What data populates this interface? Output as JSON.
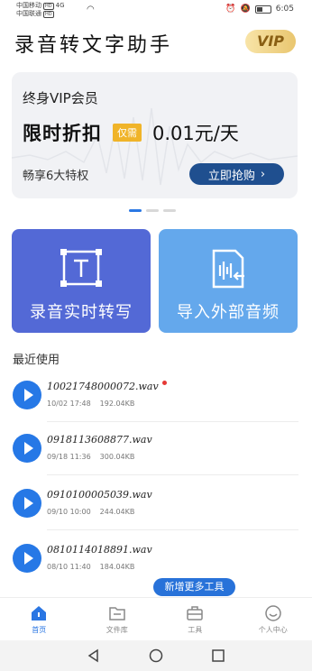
{
  "status_bar": {
    "carrier1": "中国移动",
    "carrier2": "中国联通",
    "hd": "HD",
    "net": "4G",
    "battery_level": 0.45,
    "battery_text": "Ⓔ",
    "time": "6:05"
  },
  "header": {
    "title": "录音转文字助手",
    "vip_badge": "VIP"
  },
  "vip_card": {
    "title": "终身VIP会员",
    "promo": "限时折扣",
    "tag": "仅需",
    "price": "0.01元/天",
    "benefits": "畅享6大特权",
    "buy_label": "立即抢购"
  },
  "carousel": {
    "count": 3,
    "active": 0
  },
  "tiles": {
    "record_label": "录音实时转写",
    "import_label": "导入外部音频"
  },
  "recent": {
    "title": "最近使用",
    "files": [
      {
        "name": "10021748000072.wav",
        "date": "10/02 17:48",
        "size": "192.04KB",
        "new": true
      },
      {
        "name": "0918113608877.wav",
        "date": "09/18 11:36",
        "size": "300.04KB",
        "new": false
      },
      {
        "name": "0910100005039.wav",
        "date": "09/10 10:00",
        "size": "244.04KB",
        "new": false
      },
      {
        "name": "0810114018891.wav",
        "date": "08/10 11:40",
        "size": "184.04KB",
        "new": false
      }
    ]
  },
  "more_tools": "新增更多工具",
  "bottom_nav": {
    "home": "首页",
    "files": "文件库",
    "tools": "工具",
    "profile": "个人中心"
  },
  "colors": {
    "accent": "#2678e6",
    "record_tile": "#5369d6",
    "import_tile": "#64a8ec",
    "buy_button": "#1f4f8f"
  }
}
